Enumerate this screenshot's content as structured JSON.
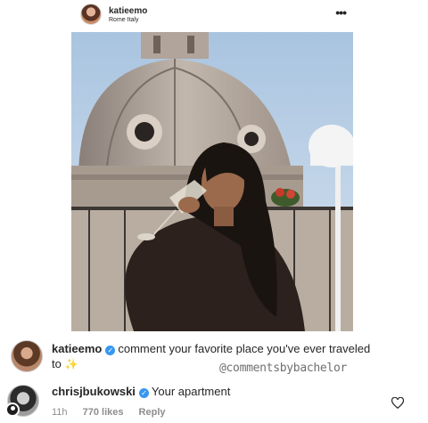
{
  "post": {
    "username": "katieemo",
    "location": "Rome Italy",
    "more_icon": "more-horizontal-icon"
  },
  "caption": {
    "username": "katieemo",
    "text": "comment your favorite place you've ever traveled to",
    "emoji": "✨",
    "verified_icon": "verified-badge-icon"
  },
  "watermark": "@commentsbybachelor",
  "comment": {
    "username": "chrisjbukowski",
    "text": "Your apartment",
    "time": "11h",
    "likes": "770 likes",
    "reply": "Reply",
    "like_icon": "heart-outline-icon"
  },
  "colors": {
    "verified": "#3897f0",
    "meta_text": "#8e8e8e",
    "text": "#262626"
  }
}
